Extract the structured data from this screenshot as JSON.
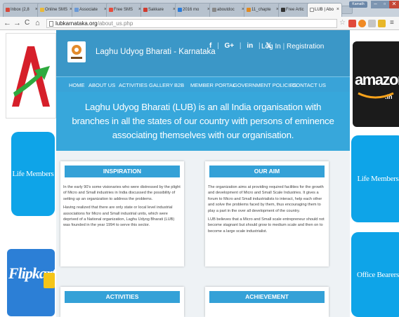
{
  "browser": {
    "tabs": [
      {
        "label": "Inbox (2,8",
        "color": "#d6493b"
      },
      {
        "label": "Online SMS",
        "color": "#e9b93a"
      },
      {
        "label": "Associate",
        "color": "#6a9ad8"
      },
      {
        "label": "Free SMS",
        "color": "#e74c3c"
      },
      {
        "label": "Sakkare",
        "color": "#d03b2f"
      },
      {
        "label": "2016 mo",
        "color": "#2d7bd8"
      },
      {
        "label": "aboutdoc",
        "color": "#888888"
      },
      {
        "label": "11_chapte",
        "color": "#e08a22"
      },
      {
        "label": "Free Artic",
        "color": "#333333"
      },
      {
        "label": "LUB | Abo",
        "color": "#ffffff"
      }
    ],
    "tab_close_glyph": "×",
    "user_label": "Kamath",
    "win_controls": {
      "minimize": "–",
      "maximize": "▫",
      "close": "✕"
    },
    "nav": {
      "back": "←",
      "forward": "→",
      "reload": "C",
      "home": "⌂"
    },
    "url_domain": "lubkarnataka.org",
    "url_path": "/about_us.php",
    "toolbar_icons": [
      "star-icon",
      "extension-icon",
      "extension-icon",
      "extension-icon",
      "extension-icon",
      "menu-icon"
    ]
  },
  "left_sidebar": {
    "logo_letter": "A",
    "tile_label": "Life Members",
    "ad_label": "Flipkart"
  },
  "right_sidebar": {
    "ad_label": "amazon",
    "ad_suffix": ".in",
    "tile1_label": "Life Members",
    "tile2_label": "Office Bearers"
  },
  "header": {
    "site_name": "Laghu Udyog Bharati - Karnataka",
    "socials": [
      "f",
      "G+",
      "in",
      "𝕏"
    ],
    "separator": "|",
    "login_label": "Log In",
    "registration_label": "Registration"
  },
  "menu": [
    "HOME",
    "ABOUT US",
    "ACTIVITIES",
    "GALLERY",
    "B2B",
    "MEMBER PORTAL",
    "GOVERNMENT POLICIES",
    "CONTACT US"
  ],
  "intro_text": "Laghu Udyog Bharati (LUB) is an all India organisation with branches in all the states of our country with persons of eminence associating themselves with our organisation.",
  "panels": {
    "inspiration": {
      "title": "INSPIRATION",
      "paragraphs": [
        "In the early 90's some visionaries who were distressed by the plight of Micro and Small industries in India discussed the possibility of setting up an organization to address the problems.",
        "Having realized that there are only state or local level industrial associations for Micro and Small industrial units, which were deprived of a National organization, Laghu Udyog Bharati (LUB) was founded in the year 1994 to serve this sector."
      ]
    },
    "aim": {
      "title": "OUR AIM",
      "paragraphs": [
        "The organization aims at providing required facilities for the growth and development of Micro and Small Scale Industries. It gives a forum to Micro and Small industrialists to interact, help each other and solve the problems faced by them, thus encouraging them to play a part in the over all development of the country.",
        "LUB believes that a Micro and Small scale entrepreneur should not become stagnant but should grow to medium scale and then on to become a large scale industrialist."
      ]
    },
    "activities": {
      "title": "ACTIVITIES"
    },
    "achievement": {
      "title": "ACHIEVEMENT"
    }
  }
}
